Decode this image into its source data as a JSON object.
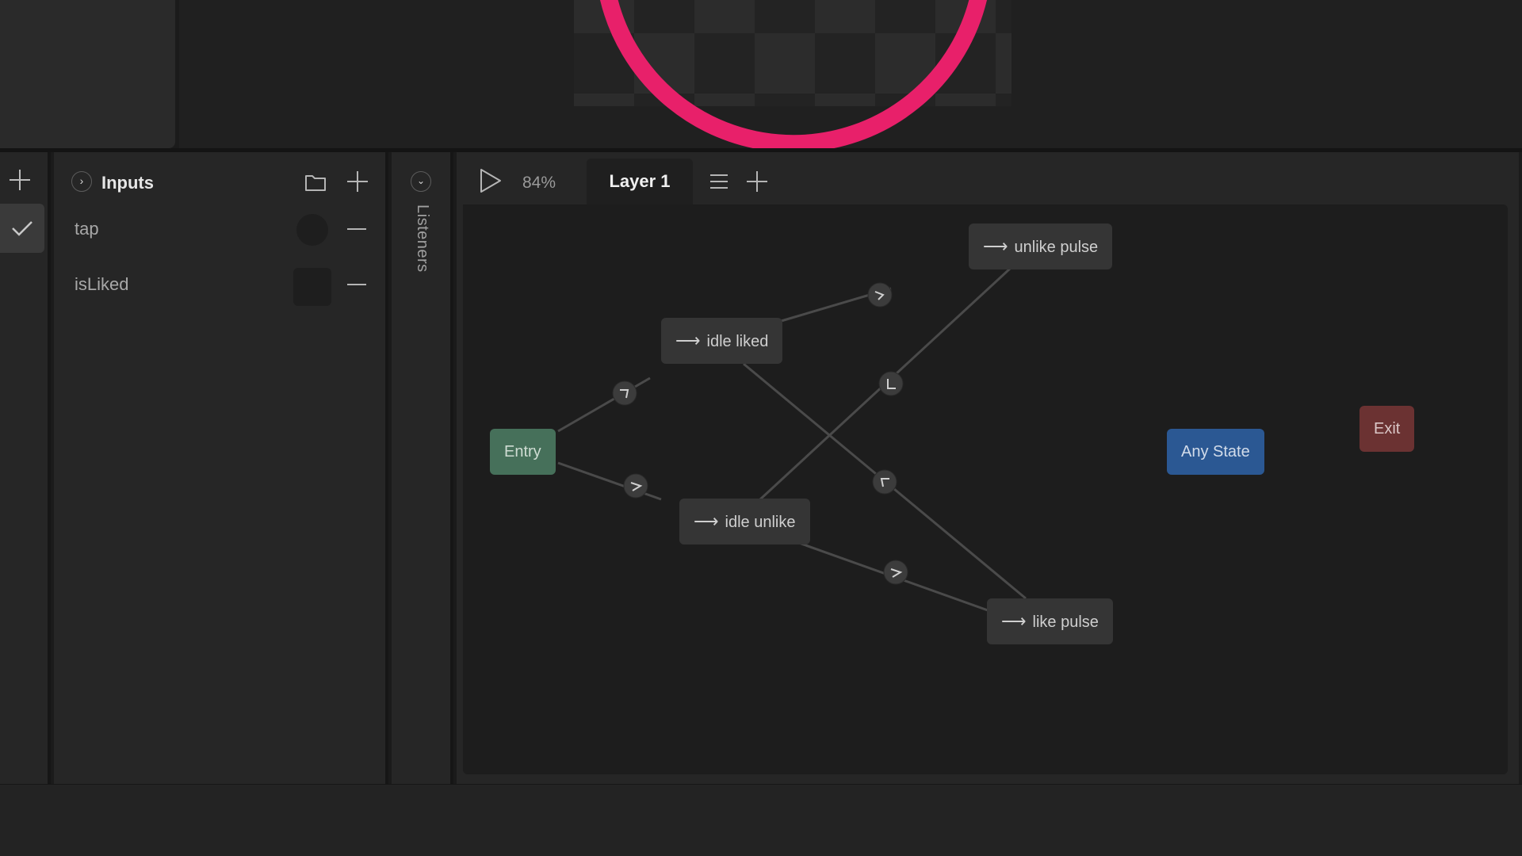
{
  "inputs_panel": {
    "title": "Inputs",
    "items": [
      {
        "label": "tap",
        "type": "trigger"
      },
      {
        "label": "isLiked",
        "type": "boolean"
      }
    ]
  },
  "listeners": {
    "label": "Listeners"
  },
  "toolbar": {
    "zoom": "84%",
    "layer_tab": "Layer 1"
  },
  "graph": {
    "nodes": {
      "entry": "Entry",
      "idle_liked": "idle liked",
      "idle_unlike": "idle unlike",
      "unlike_pulse": "unlike pulse",
      "like_pulse": "like pulse",
      "any_state": "Any State",
      "exit": "Exit"
    },
    "arrow_glyph": "⟶"
  },
  "colors": {
    "accent_ring": "#e8206a",
    "entry": "#46705a",
    "any_state": "#2b5893",
    "exit": "#6b3232"
  },
  "icons": [
    "plus-icon",
    "check-icon",
    "chevron-right-icon",
    "folder-icon",
    "minus-icon",
    "chevron-down-icon",
    "play-icon",
    "menu-icon"
  ]
}
